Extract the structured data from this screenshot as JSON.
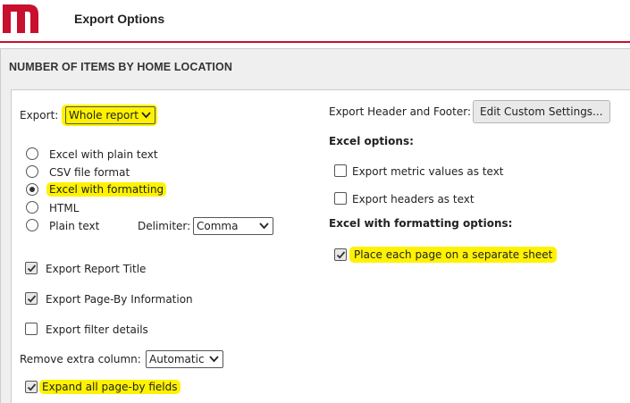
{
  "header": {
    "title": "Export Options"
  },
  "section": {
    "title": "NUMBER OF ITEMS BY HOME LOCATION"
  },
  "export": {
    "label": "Export:",
    "selected": "Whole report",
    "formats": [
      {
        "label": "Excel with plain text",
        "selected": false
      },
      {
        "label": "CSV file format",
        "selected": false
      },
      {
        "label": "Excel with formatting",
        "selected": true
      },
      {
        "label": "HTML",
        "selected": false
      },
      {
        "label": "Plain text",
        "selected": false
      }
    ],
    "delimiter_label": "Delimiter:",
    "delimiter_value": "Comma"
  },
  "left_options": [
    {
      "label": "Export Report Title",
      "checked": true
    },
    {
      "label": "Export Page-By Information",
      "checked": true
    },
    {
      "label": "Export filter details",
      "checked": false
    }
  ],
  "remove_column": {
    "label": "Remove extra column:",
    "value": "Automatic"
  },
  "expand_pageby": {
    "label": "Expand all page-by fields",
    "checked": true
  },
  "header_footer": {
    "label": "Export Header and Footer:",
    "button": "Edit Custom Settings..."
  },
  "excel_options": {
    "heading": "Excel options:",
    "items": [
      {
        "label": "Export metric values as text",
        "checked": false
      },
      {
        "label": "Export headers as text",
        "checked": false
      }
    ]
  },
  "formatting_options": {
    "heading": "Excel with formatting options:",
    "items": [
      {
        "label": "Place each page on a separate sheet",
        "checked": true
      }
    ]
  },
  "colors": {
    "brand": "#c8102e",
    "highlight": "#fff200"
  }
}
